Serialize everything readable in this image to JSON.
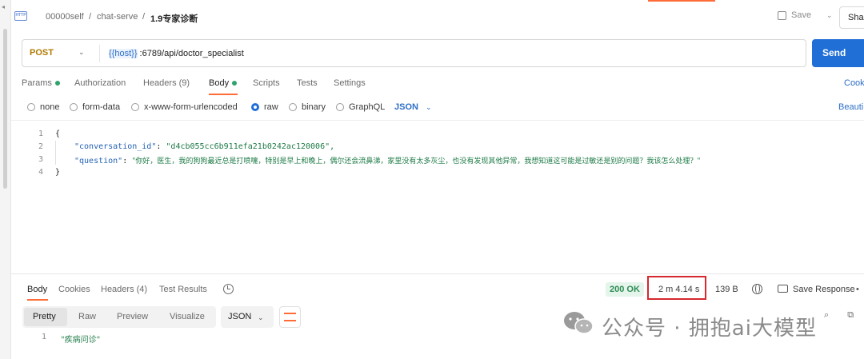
{
  "breadcrumb": {
    "workspace": "00000self",
    "collection": "chat-serve",
    "request": "1.9专家诊断",
    "separator": "/"
  },
  "header": {
    "save_label": "Save",
    "share_label": "Sha"
  },
  "request": {
    "method": "POST",
    "url_var": "{{host}}",
    "url_rest": " :6789/api/doctor_specialist",
    "send_label": "Send"
  },
  "tabs": [
    {
      "label": "Params",
      "dot": true
    },
    {
      "label": "Authorization"
    },
    {
      "label": "Headers (9)"
    },
    {
      "label": "Body",
      "dot": true,
      "active": true
    },
    {
      "label": "Scripts"
    },
    {
      "label": "Tests"
    },
    {
      "label": "Settings"
    }
  ],
  "cookies_label": "Cook",
  "body_modes": [
    "none",
    "form-data",
    "x-www-form-urlencoded",
    "raw",
    "binary",
    "GraphQL"
  ],
  "body_selected_mode": "raw",
  "body_type": "JSON",
  "beautify_label": "Beauti",
  "editor": {
    "line_numbers": [
      "1",
      "2",
      "3",
      "4"
    ],
    "open_brace": "{",
    "close_brace": "}",
    "key1": "\"conversation_id\"",
    "val1": "\"d4cb055cc6b911efa21b0242ac120006\",",
    "key2": "\"question\"",
    "val2": "\"你好，医生，我的狗狗最近总是打喷嚏，特别是早上和晚上，偶尔还会流鼻涕，家里没有太多灰尘，也没有发现其他异常，我想知道这可能是过敏还是别的问题？我该怎么处理？\"",
    "colon": ": "
  },
  "response": {
    "tabs": [
      "Body",
      "Cookies",
      "Headers (4)",
      "Test Results"
    ],
    "status": "200 OK",
    "time": "2 m 4.14 s",
    "size": "139 B",
    "save_response_label": "Save Response",
    "view_modes": [
      "Pretty",
      "Raw",
      "Preview",
      "Visualize"
    ],
    "format": "JSON",
    "line_number": "1",
    "body_text": "\"疾病问诊\""
  },
  "watermark": {
    "text": "公众号 · 拥抱ai大模型"
  },
  "colors": {
    "accent": "#ff6c37",
    "send": "#1f6fd6",
    "status_ok": "#2c8c55",
    "highlight": "#d6282e"
  },
  "icons": [
    "http-icon",
    "save-icon",
    "history-icon",
    "globe-icon",
    "save-response-icon",
    "wrap-lines-icon",
    "wechat-icon"
  ]
}
